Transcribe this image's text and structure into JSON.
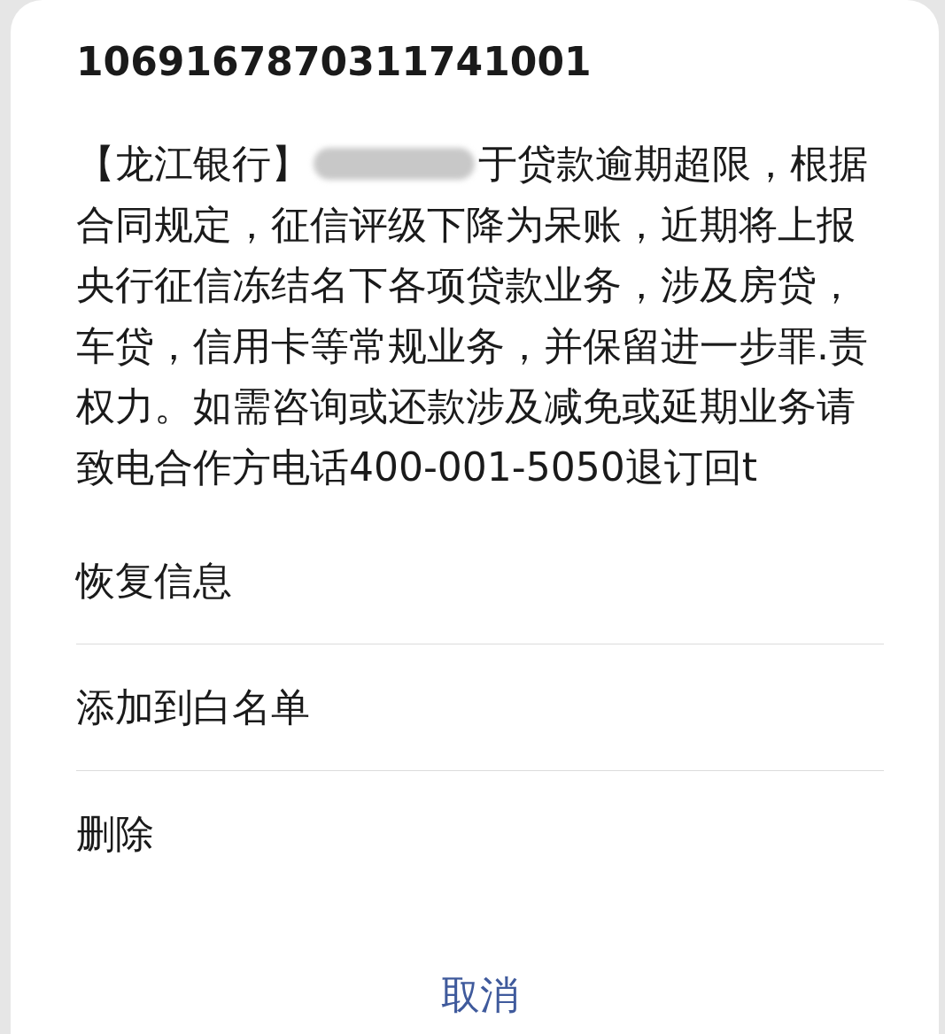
{
  "dialog": {
    "title": "1069167870311741001",
    "message": {
      "prefix": "【龙江银行】",
      "first_line_rest": "于贷款逾期超限，根据",
      "rest": "合同规定，征信评级下降为呆账，近期将上报央行征信冻结名下各项贷款业务，涉及房贷，车贷，信用卡等常规业务，并保留进一步罪.责权力。如需咨询或还款涉及减免或延期业务请致电合作方电话400-001-5050退订回t"
    },
    "options": [
      {
        "label": "恢复信息"
      },
      {
        "label": "添加到白名单"
      },
      {
        "label": "删除"
      }
    ],
    "cancel": "取消"
  }
}
